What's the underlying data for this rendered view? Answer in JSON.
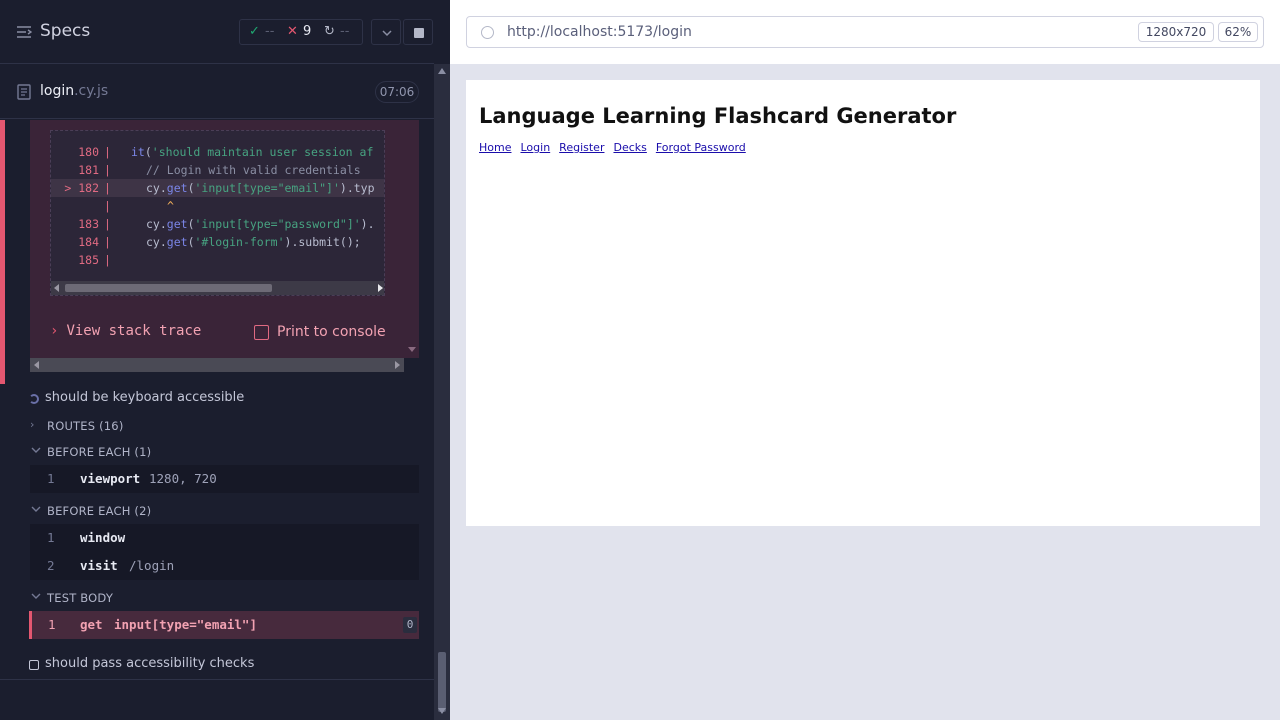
{
  "reporter": {
    "title": "Specs",
    "stats": {
      "passed": "--",
      "failed": "9",
      "pending": "--",
      "colors": {
        "passed": "#1fa971",
        "failed": "#e45770"
      }
    },
    "file": {
      "name": "login",
      "ext": ".cy.js",
      "duration": "07:06"
    },
    "error": {
      "code_lines": [
        {
          "num": "180",
          "marker": "",
          "fn": "it",
          "text": "('should maintain user session af",
          "highlight": false
        },
        {
          "num": "181",
          "marker": "",
          "comment": "// Login with valid credentials",
          "highlight": false
        },
        {
          "num": "182",
          "marker": ">",
          "prefix": "cy.",
          "fn": "get",
          "str": "'input[type=\"email\"]'",
          "suffix": ").typ",
          "highlight": true
        },
        {
          "num": "",
          "marker": "",
          "caret": "^",
          "highlight": false
        },
        {
          "num": "183",
          "marker": "",
          "prefix": "cy.",
          "fn": "get",
          "str": "'input[type=\"password\"]'",
          "suffix": ").",
          "highlight": false
        },
        {
          "num": "184",
          "marker": "",
          "prefix": "cy.",
          "fn": "get",
          "str": "'#login-form'",
          "suffix": ").submit();",
          "highlight": false
        },
        {
          "num": "185",
          "marker": "",
          "highlight": false
        }
      ],
      "view_stack_trace": "View stack trace",
      "print_to_console": "Print to console"
    },
    "tests": [
      {
        "label": "should be keyboard accessible",
        "state": "running"
      },
      {
        "label": "should pass accessibility checks",
        "state": "pending"
      }
    ],
    "sections": {
      "routes": "ROUTES (16)",
      "before_each_1": "BEFORE EACH (1)",
      "before_each_2": "BEFORE EACH (2)",
      "test_body": "TEST BODY"
    },
    "commands": {
      "before_each_1": [
        {
          "num": "1",
          "name": "viewport",
          "message": "1280, 720"
        }
      ],
      "before_each_2": [
        {
          "num": "1",
          "name": "window",
          "message": ""
        },
        {
          "num": "2",
          "name": "visit",
          "message": "/login"
        }
      ],
      "test_body": [
        {
          "num": "1",
          "name": "get",
          "message": "input[type=\"email\"]",
          "badge": "0",
          "state": "failed"
        }
      ]
    }
  },
  "aut": {
    "url": "http://localhost:5173/login",
    "viewport": "1280x720",
    "zoom": "62%",
    "app": {
      "title": "Language Learning Flashcard Generator",
      "nav": [
        "Home",
        "Login",
        "Register",
        "Decks",
        "Forgot Password"
      ]
    }
  }
}
